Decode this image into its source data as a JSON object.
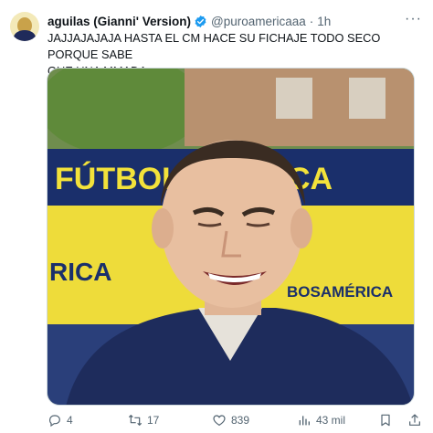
{
  "tweet": {
    "author_name": "aguilas (Gianni' Version)",
    "handle": "@puroamericaaa",
    "separator": "·",
    "time": "1h",
    "text_lines": [
      "JAJJAJAJAJA HASTA EL CM HACE SU FICHAJE TODO SECO PORQUE SABE",
      "QUE UNA MMADA"
    ],
    "media": {
      "banner_text": "FÚTBOL AMÉRICA",
      "wall_text_left": "RICA",
      "wall_text_right": "BOSAMÉRICA"
    }
  },
  "actions": {
    "replies": "4",
    "retweets": "17",
    "likes": "839",
    "views": "43 mil"
  },
  "colors": {
    "verified": "#1d9bf0",
    "text": "#0f1419",
    "muted": "#536471"
  }
}
